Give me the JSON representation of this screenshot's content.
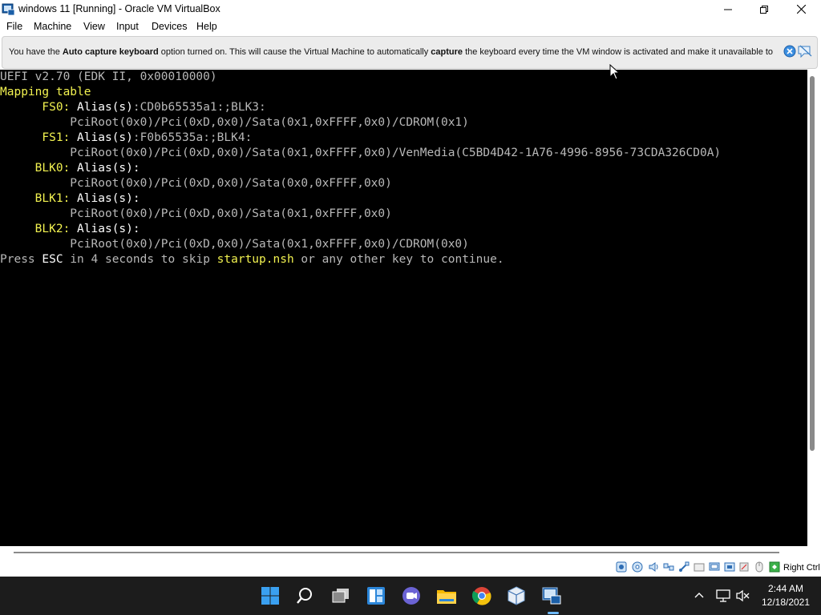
{
  "window": {
    "title": "windows 11 [Running] - Oracle VM VirtualBox",
    "icons": [
      "virtualbox-app-icon",
      "minimize-icon",
      "maximize-icon",
      "close-icon"
    ]
  },
  "menu": [
    "File",
    "Machine",
    "View",
    "Input",
    "Devices",
    "Help"
  ],
  "notification": {
    "t1": "You have the ",
    "b1": "Auto capture keyboard",
    "t2": " option turned on. This will cause the Virtual Machine to automatically ",
    "b2": "capture",
    "t3": " the keyboard every time the VM window is activated and make it unavailable to"
  },
  "console": {
    "l1": "UEFI v2.70 (EDK II, 0x00010000)",
    "l2": "Mapping table",
    "l3a": "      FS0:",
    "l3b": " Alias(s)",
    "l3c": ":CD0b65535a1:;BLK3:",
    "l4": "          PciRoot(0x0)/Pci(0xD,0x0)/Sata(0x1,0xFFFF,0x0)/CDROM(0x1)",
    "l5a": "      FS1:",
    "l5b": " Alias(s)",
    "l5c": ":F0b65535a:;BLK4:",
    "l6": "          PciRoot(0x0)/Pci(0xD,0x0)/Sata(0x1,0xFFFF,0x0)/VenMedia(C5BD4D42-1A76-4996-8956-73CDA326CD0A)",
    "l7a": "     BLK0:",
    "l7b": " Alias(s):",
    "l8": "          PciRoot(0x0)/Pci(0xD,0x0)/Sata(0x0,0xFFFF,0x0)",
    "l9a": "     BLK1:",
    "l9b": " Alias(s):",
    "l10": "          PciRoot(0x0)/Pci(0xD,0x0)/Sata(0x1,0xFFFF,0x0)",
    "l11a": "     BLK2:",
    "l11b": " Alias(s):",
    "l12": "          PciRoot(0x0)/Pci(0xD,0x0)/Sata(0x1,0xFFFF,0x0)/CDROM(0x0)",
    "l13a": "Press ",
    "l13b": "ESC",
    "l13c": " in 4 seconds to skip ",
    "l13d": "startup.nsh",
    "l13e": " or any other key to continue."
  },
  "statusbar": {
    "host_key": "Right Ctrl",
    "icons": [
      "hard-disk-icon",
      "optical-drive-icon",
      "audio-icon",
      "network-icon",
      "usb-icon",
      "shared-folders-icon",
      "display-icon",
      "recording-icon",
      "cpu-icon",
      "mouse-integration-icon",
      "keyboard-icon"
    ]
  },
  "taskbar": {
    "apps": [
      "windows-start-icon",
      "search-icon",
      "task-view-icon",
      "widgets-icon",
      "teams-chat-icon",
      "file-explorer-icon",
      "chrome-icon",
      "virtualbox-icon",
      "virtualbox-vm-icon"
    ],
    "tray": [
      "chevron-up-icon",
      "network-icon",
      "volume-muted-icon"
    ],
    "time": "2:44 AM",
    "date": "12/18/2021"
  },
  "colors": {
    "console_bg": "#000000",
    "console_yellow": "#f2f250",
    "console_gray": "#b8b8b8",
    "taskbar_bg": "#1c1c1c"
  }
}
